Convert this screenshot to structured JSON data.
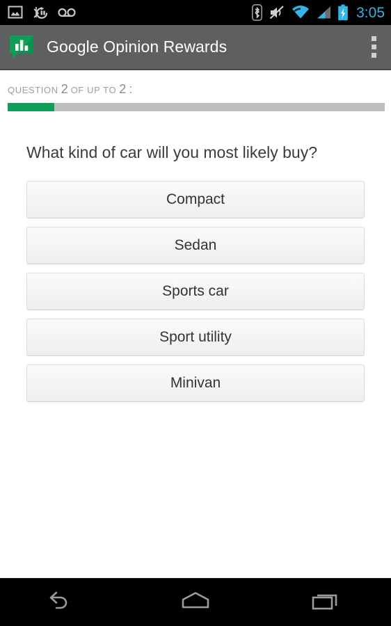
{
  "status_bar": {
    "left_icons": [
      {
        "name": "screenshot-icon",
        "label": "Screenshot captured"
      },
      {
        "name": "bluetooth-sync-icon",
        "label": "Bluetooth sync"
      },
      {
        "name": "voicemail-icon",
        "label": "Voicemail"
      }
    ],
    "right_icons": [
      {
        "name": "bluetooth-icon",
        "label": "Bluetooth"
      },
      {
        "name": "volume-muted-icon",
        "label": "Silent mode"
      },
      {
        "name": "wifi-icon",
        "label": "Wi-Fi"
      },
      {
        "name": "cell-signal-icon",
        "label": "Cellular signal"
      },
      {
        "name": "battery-charging-icon",
        "label": "Battery charging"
      }
    ],
    "time": "3:05",
    "clock_color": "#33b5e5",
    "background": "#000000"
  },
  "action_bar": {
    "app_icon_name": "google-opinion-rewards-icon",
    "title": "Google Opinion Rewards",
    "overflow_label": "More options",
    "background": "#5f5f5f",
    "title_color": "#ffffff"
  },
  "progress": {
    "label_question": "Question",
    "current": "2",
    "label_of_up_to": "of up to",
    "total": "2",
    "colon": ":",
    "percent": 12.3,
    "fill_color": "#0f9d58",
    "track_color": "#bdbdbd"
  },
  "survey": {
    "question": "What kind of car will you most likely buy?",
    "options": [
      {
        "label": "Compact"
      },
      {
        "label": "Sedan"
      },
      {
        "label": "Sports car"
      },
      {
        "label": "Sport utility"
      },
      {
        "label": "Minivan"
      }
    ]
  },
  "nav_bar": {
    "buttons": [
      {
        "name": "back-button",
        "label": "Back"
      },
      {
        "name": "home-button",
        "label": "Home"
      },
      {
        "name": "recents-button",
        "label": "Recent apps"
      }
    ],
    "background": "#000000"
  }
}
